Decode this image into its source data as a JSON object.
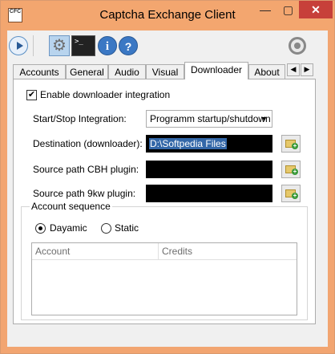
{
  "window": {
    "title": "Captcha Exchange Client",
    "icon_text": "CFC",
    "controls": {
      "minimize": "—",
      "maximize": "▢",
      "close": "✕"
    }
  },
  "toolbar": {
    "info_glyph": "i",
    "help_glyph": "?"
  },
  "tabs": [
    {
      "label": "Accounts",
      "active": false
    },
    {
      "label": "General",
      "active": false
    },
    {
      "label": "Audio",
      "active": false
    },
    {
      "label": "Visual",
      "active": false
    },
    {
      "label": "Downloader",
      "active": true
    },
    {
      "label": "About",
      "active": false
    }
  ],
  "tab_scroll": {
    "left": "◀",
    "right": "▶"
  },
  "downloader": {
    "enable_label": "Enable downloader integration",
    "enable_checked": true,
    "check_glyph": "✔",
    "start_stop_label": "Start/Stop Integration:",
    "start_stop_value": "Programm startup/shutdown",
    "dropdown_arrow": "▼",
    "destination_label": "Destination (downloader):",
    "destination_value": "D:\\Softpedia Files",
    "cbh_label": "Source path CBH plugin:",
    "cbh_value": "",
    "ninekw_label": "Source path 9kw plugin:",
    "ninekw_value": ""
  },
  "account_sequence": {
    "legend": "Account sequence",
    "options": [
      {
        "label": "Dayamic",
        "selected": true
      },
      {
        "label": "Static",
        "selected": false
      }
    ],
    "columns": [
      "Account",
      "Credits"
    ],
    "rows": []
  }
}
